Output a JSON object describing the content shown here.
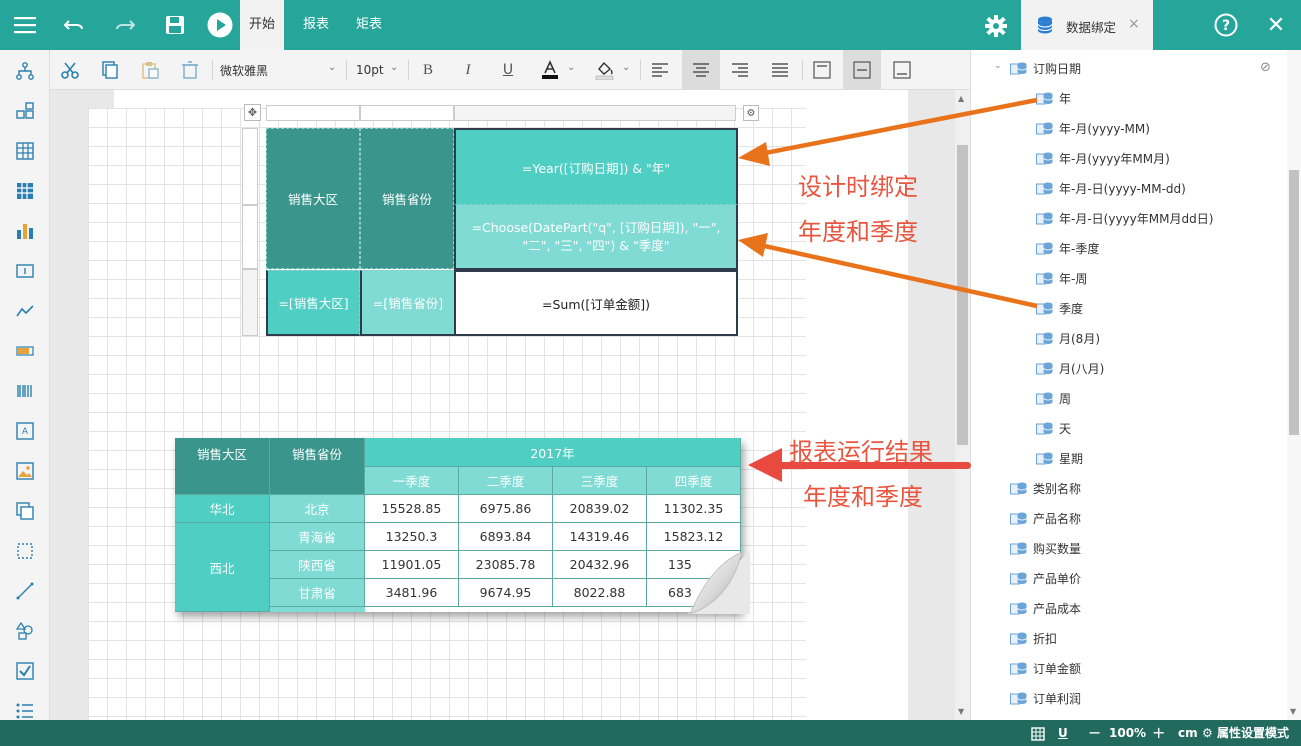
{
  "toolbar": {
    "tabs": [
      "开始",
      "报表",
      "矩表"
    ],
    "panel_tab": "数据绑定",
    "font_name": "微软雅黑",
    "font_size": "10pt"
  },
  "statusbar": {
    "zoom": "100%",
    "unit": "cm",
    "mode": "属性设置模式"
  },
  "tree": {
    "date_field": "订购日期",
    "date_children": [
      "年",
      "年-月(yyyy-MM)",
      "年-月(yyyy年MM月)",
      "年-月-日(yyyy-MM-dd)",
      "年-月-日(yyyy年MM月dd日)",
      "年-季度",
      "年-周",
      "季度",
      "月(8月)",
      "月(八月)",
      "周",
      "天",
      "星期"
    ],
    "fields": [
      "类别名称",
      "产品名称",
      "购买数量",
      "产品单价",
      "产品成本",
      "折扣",
      "订单金额",
      "订单利润"
    ]
  },
  "design": {
    "region_header": "销售大区",
    "province_header": "销售省份",
    "year_expr": "=Year([订购日期]) & \"年\"",
    "quarter_expr": "=Choose(DatePart(\"q\", [订购日期]), \"一\", \"二\", \"三\", \"四\") & \"季度\"",
    "region_field": "=[销售大区]",
    "province_field": "=[销售省份]",
    "sum_expr": "=Sum([订单金额])"
  },
  "result": {
    "region_header": "销售大区",
    "province_header": "销售省份",
    "year": "2017年",
    "quarters": [
      "一季度",
      "二季度",
      "三季度",
      "四季度"
    ],
    "rows": [
      {
        "region": "华北",
        "province": "北京",
        "values": [
          "15528.85",
          "6975.86",
          "20839.02",
          "11302.35"
        ]
      },
      {
        "region": "西北",
        "province": "青海省",
        "values": [
          "13250.3",
          "6893.84",
          "14319.46",
          "15823.12"
        ]
      },
      {
        "region": "",
        "province": "陕西省",
        "values": [
          "11901.05",
          "23085.78",
          "20432.96",
          "135"
        ]
      },
      {
        "region": "",
        "province": "甘肃省",
        "values": [
          "3481.96",
          "9674.95",
          "8022.88",
          "683"
        ]
      }
    ]
  },
  "annotations": {
    "design_line1": "设计时绑定",
    "design_line2": "年度和季度",
    "result_line1": "报表运行结果",
    "result_line2": "年度和季度"
  },
  "colors": {
    "brand": "#26a69a",
    "status": "#22695e",
    "arrow_orange": "#e8731a",
    "arrow_red": "#e84a3f"
  }
}
